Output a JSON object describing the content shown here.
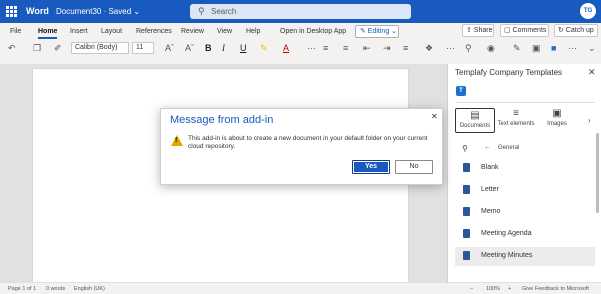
{
  "titlebar": {
    "app_name": "Word",
    "doc_name": "Document30 · Saved ⌄",
    "search_placeholder": "Search",
    "avatar": "TG"
  },
  "ribbon": {
    "tabs": [
      "File",
      "Home",
      "Insert",
      "Layout",
      "References",
      "Review",
      "View",
      "Help"
    ],
    "open_desktop": "Open in Desktop App",
    "editing": "✎ Editing ⌄",
    "share": "⇪ Share",
    "comments": "▢ Comments",
    "catchup": "↻ Catch up",
    "font_name": "Calibri (Body)",
    "font_size": "11"
  },
  "pane": {
    "title": "Templafy Company Templates",
    "logo": "T",
    "tabs": [
      {
        "label": "Documents",
        "icon": "▤"
      },
      {
        "label": "Text elements",
        "icon": "≡"
      },
      {
        "label": "Images",
        "icon": "▣"
      }
    ],
    "breadcrumb": "General",
    "templates": [
      "Blank",
      "Letter",
      "Memo",
      "Meeting Agenda",
      "Meeting Minutes"
    ]
  },
  "dialog": {
    "title": "Message from add-in",
    "message": "This add-in is about to create a new document in your default folder on your current cloud repository.",
    "yes": "Yes",
    "no": "No"
  },
  "statusbar": {
    "page": "Page 1 of 1",
    "words": "0 words",
    "language": "English (UK)",
    "zoom": "100%",
    "feedback": "Give Feedback to Microsoft"
  }
}
